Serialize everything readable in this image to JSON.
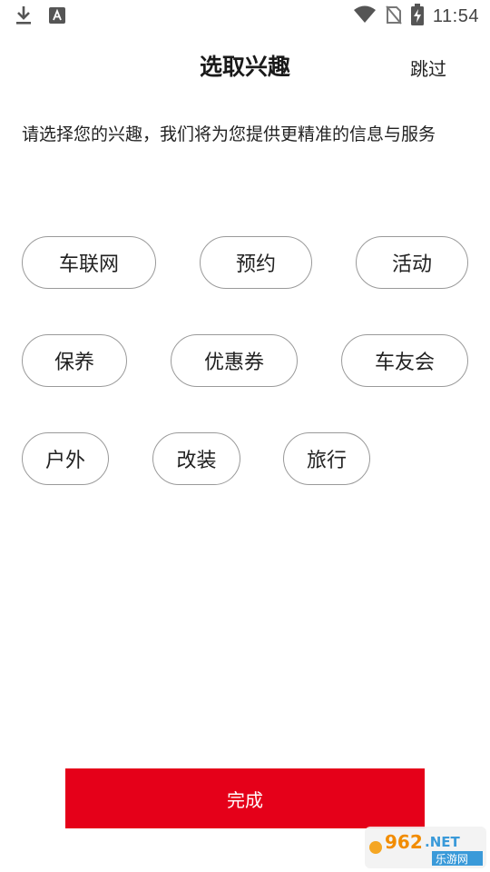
{
  "status_bar": {
    "time": "11:54",
    "icons": [
      "download-icon",
      "keyboard-a-icon",
      "wifi-icon",
      "no-sim-icon",
      "battery-charging-icon"
    ]
  },
  "header": {
    "title": "选取兴趣",
    "skip_label": "跳过"
  },
  "instruction": "请选择您的兴趣，我们将为您提供更精准的信息与服务",
  "interests": [
    {
      "label": "车联网"
    },
    {
      "label": "预约"
    },
    {
      "label": "活动"
    },
    {
      "label": "保养"
    },
    {
      "label": "优惠券"
    },
    {
      "label": "车友会"
    },
    {
      "label": "户外"
    },
    {
      "label": "改装"
    },
    {
      "label": "旅行"
    }
  ],
  "done_label": "完成",
  "watermark": {
    "logo_text": "962.NET",
    "caption": "乐游网"
  },
  "colors": {
    "accent": "#e50019",
    "chip_border": "#9a9a9a",
    "text": "#222222"
  }
}
